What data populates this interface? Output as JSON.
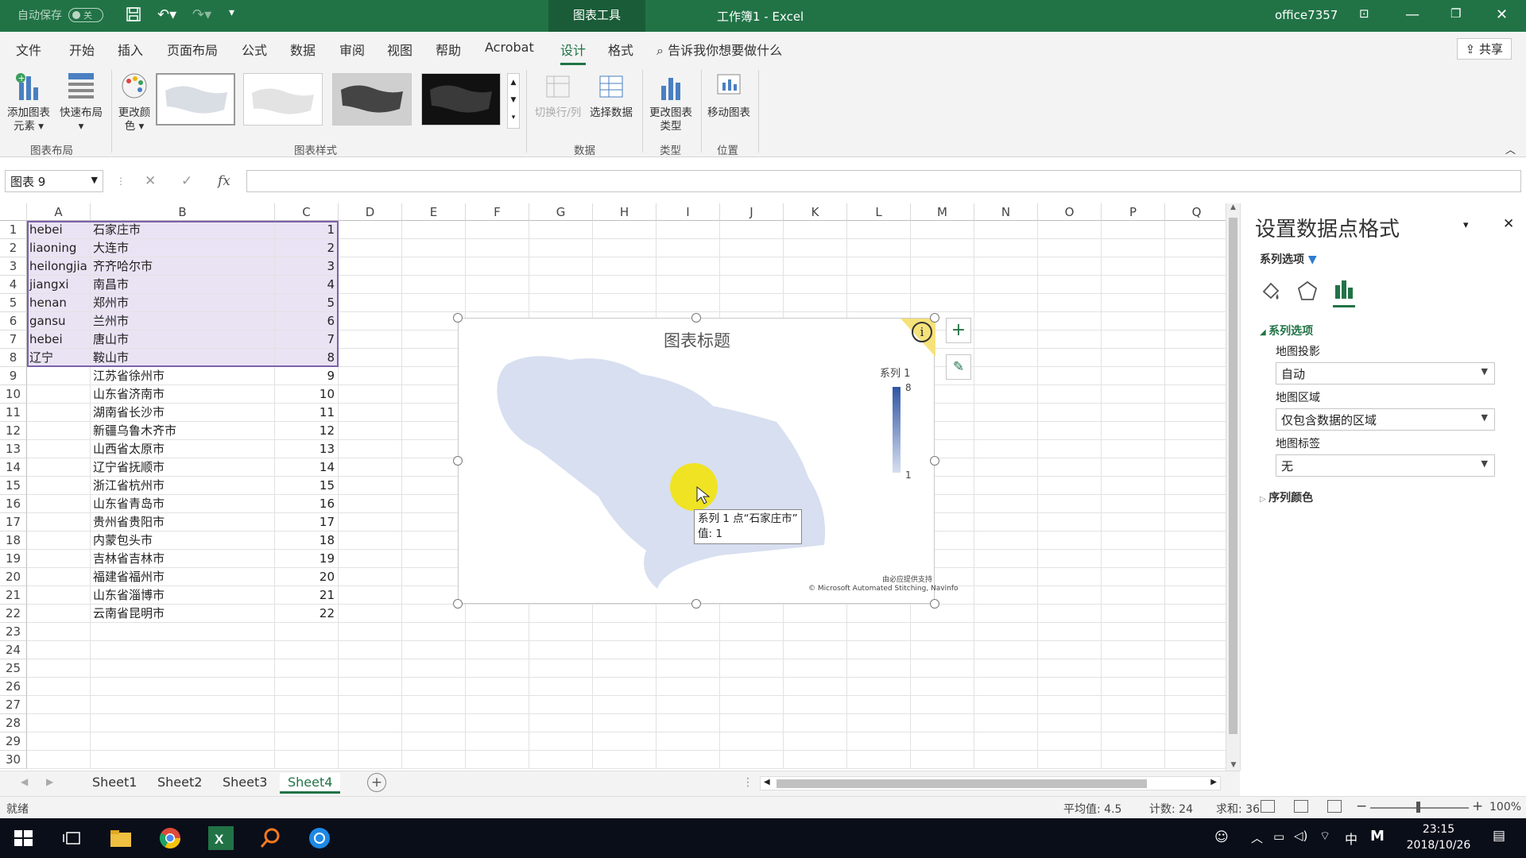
{
  "titlebar": {
    "autosave_label": "自动保存",
    "autosave_state": "关",
    "context_tab": "图表工具",
    "doc_title": "工作簿1 - Excel",
    "user": "office7357"
  },
  "menu": {
    "tabs": [
      "文件",
      "开始",
      "插入",
      "页面布局",
      "公式",
      "数据",
      "审阅",
      "视图",
      "帮助",
      "Acrobat",
      "设计",
      "格式"
    ],
    "active": "设计",
    "tell_me": "告诉我你想要做什么",
    "share": "共享"
  },
  "ribbon": {
    "add_element": "添加图表元素",
    "quick_layout": "快速布局",
    "change_color": "更改颜色",
    "group_layout": "图表布局",
    "group_styles": "图表样式",
    "switch_row_col": "切换行/列",
    "select_data": "选择数据",
    "group_data": "数据",
    "change_type": "更改图表类型",
    "group_type": "类型",
    "move_chart": "移动图表",
    "group_location": "位置"
  },
  "formula": {
    "name_box": "图表 9",
    "fx": "fx",
    "content": ""
  },
  "columns": [
    "A",
    "B",
    "C",
    "D",
    "E",
    "F",
    "G",
    "H",
    "I",
    "J",
    "K",
    "L",
    "M",
    "N",
    "O",
    "P",
    "Q"
  ],
  "rows": [
    {
      "n": "1",
      "a": "hebei",
      "b": "石家庄市",
      "c": "1"
    },
    {
      "n": "2",
      "a": "liaoning",
      "b": "大连市",
      "c": "2"
    },
    {
      "n": "3",
      "a": "heilongjia",
      "b": "齐齐哈尔市",
      "c": "3"
    },
    {
      "n": "4",
      "a": "jiangxi",
      "b": "南昌市",
      "c": "4"
    },
    {
      "n": "5",
      "a": "henan",
      "b": "郑州市",
      "c": "5"
    },
    {
      "n": "6",
      "a": "gansu",
      "b": "兰州市",
      "c": "6"
    },
    {
      "n": "7",
      "a": "hebei",
      "b": "唐山市",
      "c": "7"
    },
    {
      "n": "8",
      "a": "辽宁",
      "b": "鞍山市",
      "c": "8"
    },
    {
      "n": "9",
      "a": "",
      "b": "江苏省徐州市",
      "c": "9"
    },
    {
      "n": "10",
      "a": "",
      "b": "山东省济南市",
      "c": "10"
    },
    {
      "n": "11",
      "a": "",
      "b": "湖南省长沙市",
      "c": "11"
    },
    {
      "n": "12",
      "a": "",
      "b": "新疆乌鲁木齐市",
      "c": "12"
    },
    {
      "n": "13",
      "a": "",
      "b": "山西省太原市",
      "c": "13"
    },
    {
      "n": "14",
      "a": "",
      "b": "辽宁省抚顺市",
      "c": "14"
    },
    {
      "n": "15",
      "a": "",
      "b": "浙江省杭州市",
      "c": "15"
    },
    {
      "n": "16",
      "a": "",
      "b": "山东省青岛市",
      "c": "16"
    },
    {
      "n": "17",
      "a": "",
      "b": "贵州省贵阳市",
      "c": "17"
    },
    {
      "n": "18",
      "a": "",
      "b": "内蒙包头市",
      "c": "18"
    },
    {
      "n": "19",
      "a": "",
      "b": "吉林省吉林市",
      "c": "19"
    },
    {
      "n": "20",
      "a": "",
      "b": "福建省福州市",
      "c": "20"
    },
    {
      "n": "21",
      "a": "",
      "b": "山东省淄博市",
      "c": "21"
    },
    {
      "n": "22",
      "a": "",
      "b": "云南省昆明市",
      "c": "22"
    },
    {
      "n": "23",
      "a": "",
      "b": "",
      "c": ""
    },
    {
      "n": "24",
      "a": "",
      "b": "",
      "c": ""
    },
    {
      "n": "25",
      "a": "",
      "b": "",
      "c": ""
    },
    {
      "n": "26",
      "a": "",
      "b": "",
      "c": ""
    },
    {
      "n": "27",
      "a": "",
      "b": "",
      "c": ""
    },
    {
      "n": "28",
      "a": "",
      "b": "",
      "c": ""
    },
    {
      "n": "29",
      "a": "",
      "b": "",
      "c": ""
    },
    {
      "n": "30",
      "a": "",
      "b": "",
      "c": ""
    }
  ],
  "chart": {
    "title": "图表标题",
    "legend_series": "系列 1",
    "legend_max": "8",
    "legend_min": "1",
    "tooltip_line1": "系列 1 点“石家庄市”",
    "tooltip_line2": "值: 1",
    "credit1": "由必应提供支持",
    "credit2": "© Microsoft Automated Stitching, Navinfo",
    "fill_color": "#d7dff0",
    "legend_dark": "#2f55a4",
    "highlight_color": "#f3e400"
  },
  "pane": {
    "title": "设置数据点格式",
    "series_options_dropdown": "系列选项",
    "section": "系列选项",
    "projection_label": "地图投影",
    "projection_value": "自动",
    "area_label": "地图区域",
    "area_value": "仅包含数据的区域",
    "labels_label": "地图标签",
    "labels_value": "无",
    "series_color": "序列颜色"
  },
  "sheets": [
    "Sheet1",
    "Sheet2",
    "Sheet3",
    "Sheet4"
  ],
  "active_sheet": "Sheet4",
  "status": {
    "ready": "就绪",
    "average": "平均值: 4.5",
    "count": "计数: 24",
    "sum": "求和: 36",
    "zoom": "100%"
  },
  "taskbar": {
    "time": "23:15",
    "date": "2018/10/26",
    "ime": "中",
    "ime2": "M"
  }
}
